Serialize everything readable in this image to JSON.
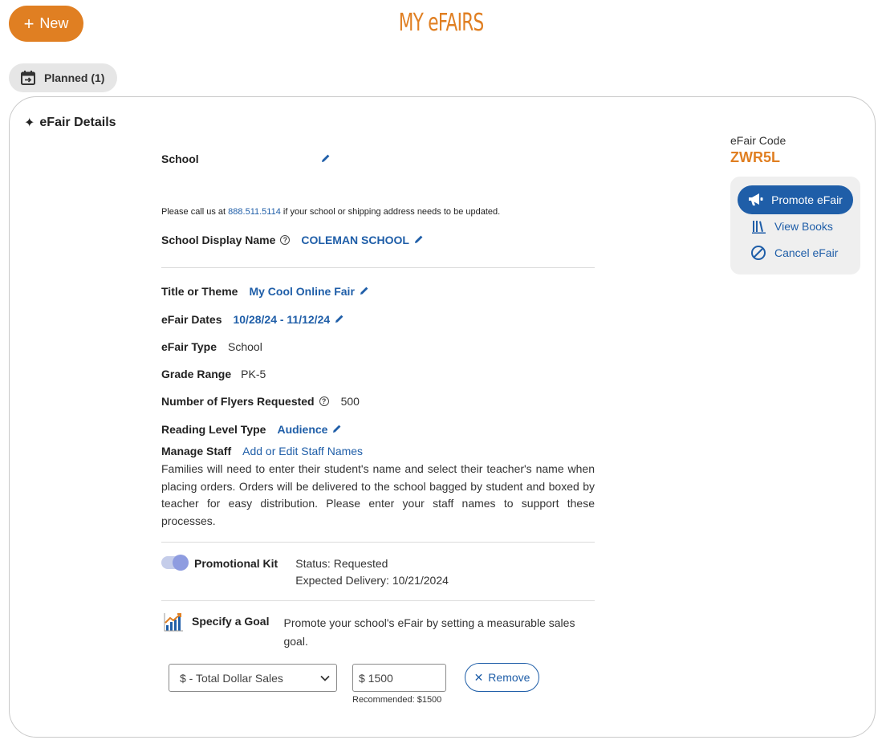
{
  "header": {
    "new_button_label": "New",
    "page_title": "MY eFAIRS"
  },
  "tabs": [
    {
      "label": "Planned (1)"
    }
  ],
  "card": {
    "title": "eFair Details",
    "school_label": "School",
    "address_note_prefix": "Please call us at ",
    "address_note_phone": "888.511.5114",
    "address_note_suffix": " if your school or shipping address needs to be updated.",
    "display_name_label": "School Display Name",
    "display_name_value": "COLEMAN SCHOOL",
    "title_label": "Title or Theme",
    "title_value": "My Cool Online Fair",
    "dates_label": "eFair Dates",
    "dates_value": "10/28/24 - 11/12/24",
    "type_label": "eFair Type",
    "type_value": "School",
    "grade_label": "Grade Range",
    "grade_value": "PK-5",
    "flyers_label": "Number of Flyers Requested",
    "flyers_value": "500",
    "reading_label": "Reading Level Type",
    "reading_value": "Audience",
    "staff_label": "Manage Staff",
    "staff_link": "Add or Edit Staff Names",
    "staff_description": "Families will need to enter their student's name and select their teacher's name when placing orders. Orders will be delivered to the school bagged by student and boxed by teacher for easy distribution. Please enter your staff names to support these processes.",
    "promo_label": "Promotional Kit",
    "promo_status": "Status: Requested",
    "promo_delivery": "Expected Delivery: 10/21/2024",
    "goal_label": "Specify a Goal",
    "goal_description_1": "Promote your school's eFair by setting a measurable sales",
    "goal_description_2": "goal.",
    "goal_select_value": "$ - Total Dollar Sales",
    "goal_amount": "$ 1500",
    "goal_recommended": "Recommended: $1500",
    "remove_label": "Remove"
  },
  "sidebar": {
    "code_label": "eFair Code",
    "code_value": "ZWR5L",
    "promote_label": "Promote eFair",
    "view_books_label": "View Books",
    "cancel_label": "Cancel eFair"
  },
  "colors": {
    "accent_orange": "#e07f22",
    "link_blue": "#1f5ea8"
  }
}
